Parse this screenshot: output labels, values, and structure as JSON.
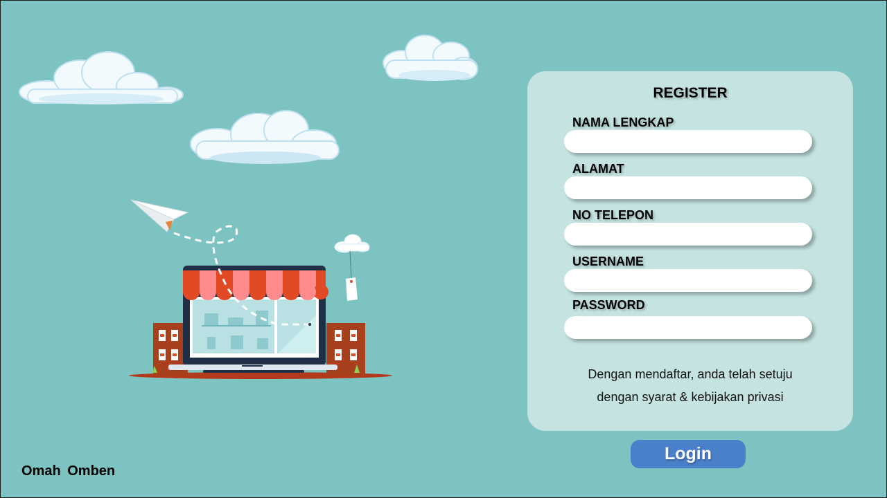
{
  "brand": {
    "name": "Omah  Omben"
  },
  "register": {
    "title": "REGISTER",
    "fields": [
      {
        "label": "NAMA LENGKAP",
        "value": ""
      },
      {
        "label": "ALAMAT",
        "value": ""
      },
      {
        "label": "NO TELEPON",
        "value": ""
      },
      {
        "label": "USERNAME",
        "value": ""
      },
      {
        "label": "PASSWORD",
        "value": ""
      }
    ],
    "terms": {
      "line1": "Dengan mendaftar, anda telah setuju",
      "line2": "dengan syarat & kebijakan privasi"
    }
  },
  "actions": {
    "login_label": "Login"
  },
  "colors": {
    "background": "#7cc3c1",
    "card": "#c4e3e1",
    "button": "#4a80c9",
    "input": "#ffffff"
  },
  "icons": {
    "clouds": "cloud-icon",
    "illustration": "online-store-laptop-icon",
    "paper_plane": "paper-plane-icon",
    "price_tag": "price-tag-icon"
  }
}
